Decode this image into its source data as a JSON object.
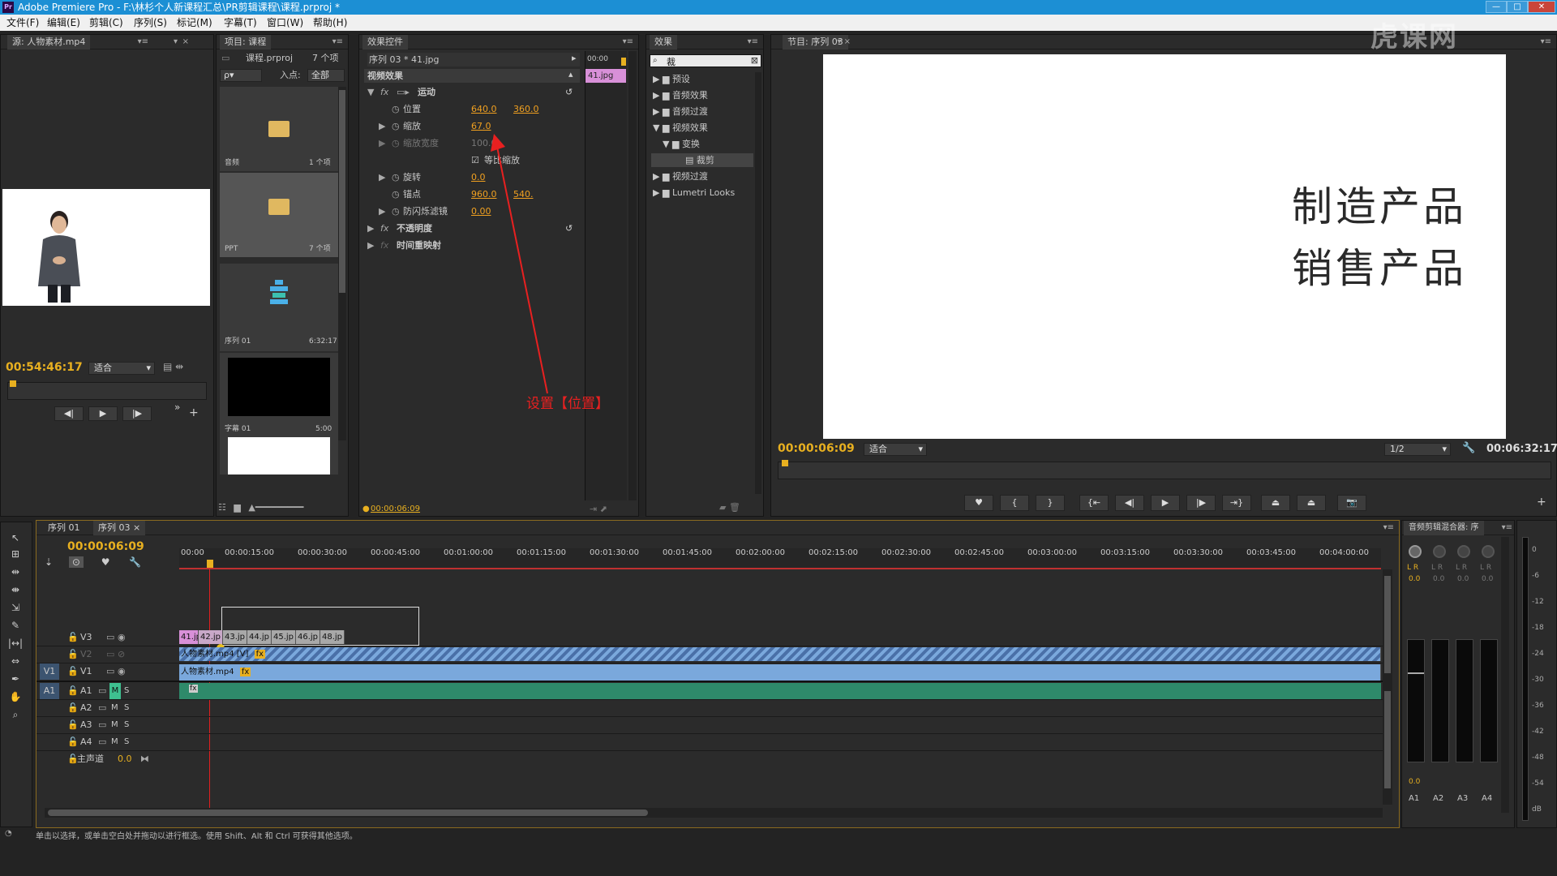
{
  "window": {
    "app_icon": "Pr",
    "title": "Adobe Premiere Pro - F:\\林杉个人新课程汇总\\PR剪辑课程\\课程.prproj *",
    "minimize": "—",
    "maximize": "□",
    "close": "✕"
  },
  "menu": [
    "文件(F)",
    "编辑(E)",
    "剪辑(C)",
    "序列(S)",
    "标记(M)",
    "字幕(T)",
    "窗口(W)",
    "帮助(H)"
  ],
  "source_panel": {
    "tab": "源: 人物素材.mp4",
    "timecode": "00:54:46:17",
    "fit": "适合"
  },
  "project_panel": {
    "tab": "项目: 课程",
    "project_file": "课程.prproj",
    "item_count": "7 个项",
    "search_placeholder": "ρ▾",
    "in_label": "入点:",
    "in_value": "全部",
    "items": [
      {
        "name": "音频",
        "meta": "1 个项"
      },
      {
        "name": "PPT",
        "meta": "7 个项"
      },
      {
        "name": "序列 01",
        "meta": "6:32:17"
      },
      {
        "name": "字幕 01",
        "meta": "5:00"
      }
    ]
  },
  "effect_controls": {
    "tab": "效果控件",
    "header": "序列 03 * 41.jpg",
    "mini_time": "00:00",
    "mini_clip": "41.jpg",
    "video_effects": "视频效果",
    "motion": "运动",
    "fx": "fx",
    "position_label": "位置",
    "position_x": "640.0",
    "position_y": "360.0",
    "scale_label": "缩放",
    "scale_value": "67.0",
    "scale_width_label": "缩放宽度",
    "scale_width_value": "100.0",
    "uniform_label": "等比缩放",
    "rotation_label": "旋转",
    "rotation_value": "0.0",
    "anchor_label": "锚点",
    "anchor_x": "960.0",
    "anchor_y": "540.",
    "flicker_label": "防闪烁滤镜",
    "flicker_value": "0.00",
    "opacity": "不透明度",
    "time_remap": "时间重映射",
    "timecode": "00:00:06:09",
    "annotation": "设置【位置】"
  },
  "effects_panel": {
    "tab": "效果",
    "search_value": "裁",
    "tree": [
      {
        "label": "预设",
        "level": 0,
        "open": false
      },
      {
        "label": "音频效果",
        "level": 0,
        "open": false
      },
      {
        "label": "音频过渡",
        "level": 0,
        "open": false
      },
      {
        "label": "视频效果",
        "level": 0,
        "open": true
      },
      {
        "label": "变换",
        "level": 1,
        "open": true
      },
      {
        "label": "裁剪",
        "level": 2,
        "open": false
      },
      {
        "label": "视频过渡",
        "level": 0,
        "open": false
      },
      {
        "label": "Lumetri Looks",
        "level": 0,
        "open": false
      }
    ]
  },
  "program_monitor": {
    "tab": "节目: 序列 03",
    "line1": "制造产品",
    "line2": "销售产品",
    "timecode": "00:00:06:09",
    "fit": "适合",
    "resolution": "1/2",
    "duration": "00:06:32:17"
  },
  "timeline": {
    "tabs": [
      "序列 01",
      "序列 03"
    ],
    "timecode": "00:00:06:09",
    "ruler": [
      "00:00",
      "00:00:15:00",
      "00:00:30:00",
      "00:00:45:00",
      "00:01:00:00",
      "00:01:15:00",
      "00:01:30:00",
      "00:01:45:00",
      "00:02:00:00",
      "00:02:15:00",
      "00:02:30:00",
      "00:02:45:00",
      "00:03:00:00",
      "00:03:15:00",
      "00:03:30:00",
      "00:03:45:00",
      "00:04:00:00"
    ],
    "v3_clips": [
      "41.jp",
      "42.jp",
      "43.jp",
      "44.jp",
      "45.jp",
      "46.jp",
      "48.jp"
    ],
    "v2_clip": "人物素材.mp4 [V]",
    "v1_clip": "人物素材.mp4",
    "tracks": {
      "v3": "V3",
      "v2": "V2",
      "v1": "V1",
      "src_v1": "V1",
      "a1": "A1",
      "src_a1": "A1",
      "a2": "A2",
      "a3": "A3",
      "a4": "A4",
      "master": "主声道",
      "master_value": "0.0",
      "m": "M",
      "s": "S"
    }
  },
  "audio_mixer": {
    "tab": "音频剪辑混合器: 序",
    "lr": "L R",
    "channels": [
      "A1",
      "A2",
      "A3",
      "A4"
    ],
    "values": [
      "0.0",
      "0.0",
      "0.0",
      "0.0"
    ],
    "bottom_value": "0.0",
    "db_scale": [
      "0",
      "-6",
      "-12",
      "-18",
      "-24",
      "-30",
      "-36",
      "-42",
      "-48",
      "-54",
      "dB"
    ]
  },
  "status_bar": "单击以选择，或单击空白处并拖动以进行框选。使用 Shift、Alt 和 Ctrl 可获得其他选项。",
  "watermark": "虎课网",
  "colors": {
    "accent": "#1c8fd4",
    "timecode": "#e8b020",
    "clip_pink": "#d890d8",
    "clip_blue": "#7aa8dc",
    "audio_green": "#2e8a6a",
    "annotation": "#e82020"
  }
}
